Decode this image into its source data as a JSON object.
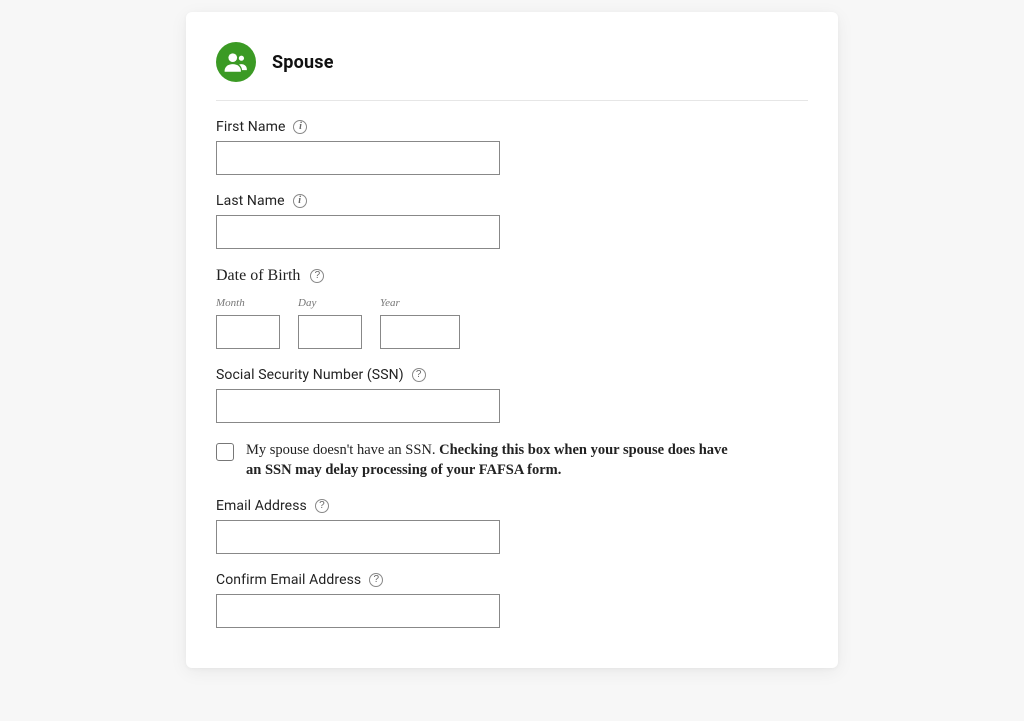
{
  "header": {
    "title": "Spouse"
  },
  "fields": {
    "first_name": {
      "label": "First Name",
      "value": ""
    },
    "last_name": {
      "label": "Last Name",
      "value": ""
    },
    "dob": {
      "section_label": "Date of Birth",
      "month_label": "Month",
      "day_label": "Day",
      "year_label": "Year",
      "month_value": "",
      "day_value": "",
      "year_value": ""
    },
    "ssn": {
      "label": "Social Security Number (SSN)",
      "value": ""
    },
    "no_ssn_checkbox": {
      "text_plain": "My spouse doesn't have an SSN. ",
      "text_bold": "Checking this box when your spouse does have an SSN may delay processing of your FAFSA form.",
      "checked": false
    },
    "email": {
      "label": "Email Address",
      "value": ""
    },
    "confirm_email": {
      "label": "Confirm Email Address",
      "value": ""
    }
  }
}
